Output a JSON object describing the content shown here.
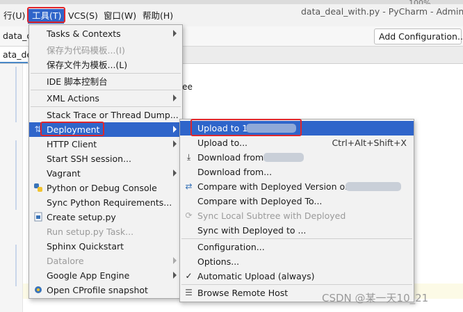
{
  "window": {
    "title": "data_deal_with.py - PyCharm - Admin",
    "zoom": "100%"
  },
  "menubar": {
    "items": [
      {
        "label": "行(U)"
      },
      {
        "label": "工具(T)"
      },
      {
        "label": "VCS(S)"
      },
      {
        "label": "窗口(W)"
      },
      {
        "label": "帮助(H)"
      }
    ]
  },
  "navbar": {
    "file_crumb": "data_d",
    "add_config_label": "Add Configuration..."
  },
  "editor": {
    "tab_label": "ata_de",
    "code_fragment": "ee"
  },
  "tools_menu": {
    "items": [
      {
        "label": "Tasks & Contexts"
      },
      {
        "label": "保存为代码模板...(I)"
      },
      {
        "label": "保存文件为模板...(L)"
      },
      {
        "label": "IDE 脚本控制台"
      },
      {
        "label": "XML Actions"
      },
      {
        "label": "Stack Trace or Thread Dump..."
      },
      {
        "label": "Deployment"
      },
      {
        "label": "HTTP Client"
      },
      {
        "label": "Start SSH session..."
      },
      {
        "label": "Vagrant"
      },
      {
        "label": "Python or Debug Console"
      },
      {
        "label": "Sync Python Requirements..."
      },
      {
        "label": "Create setup.py"
      },
      {
        "label": "Run setup.py Task..."
      },
      {
        "label": "Sphinx Quickstart"
      },
      {
        "label": "Datalore"
      },
      {
        "label": "Google App Engine"
      },
      {
        "label": "Open CProfile snapshot"
      }
    ]
  },
  "deployment_menu": {
    "items": [
      {
        "label": "Upload to 1"
      },
      {
        "label": "Upload to...",
        "shortcut": "Ctrl+Alt+Shift+X"
      },
      {
        "label": "Download from 1"
      },
      {
        "label": "Download from..."
      },
      {
        "label": "Compare with Deployed Version on 1"
      },
      {
        "label": "Compare with Deployed To..."
      },
      {
        "label": "Sync Local Subtree with Deployed"
      },
      {
        "label": "Sync with Deployed to ..."
      },
      {
        "label": "Configuration..."
      },
      {
        "label": "Options..."
      },
      {
        "label": "Automatic Upload (always)"
      },
      {
        "label": "Browse Remote Host"
      }
    ]
  },
  "watermark": "CSDN @某一天10_21",
  "colors": {
    "selection": "#2f65ca",
    "highlight_box": "#e0262b",
    "menu_bg": "#f2f2f2"
  }
}
